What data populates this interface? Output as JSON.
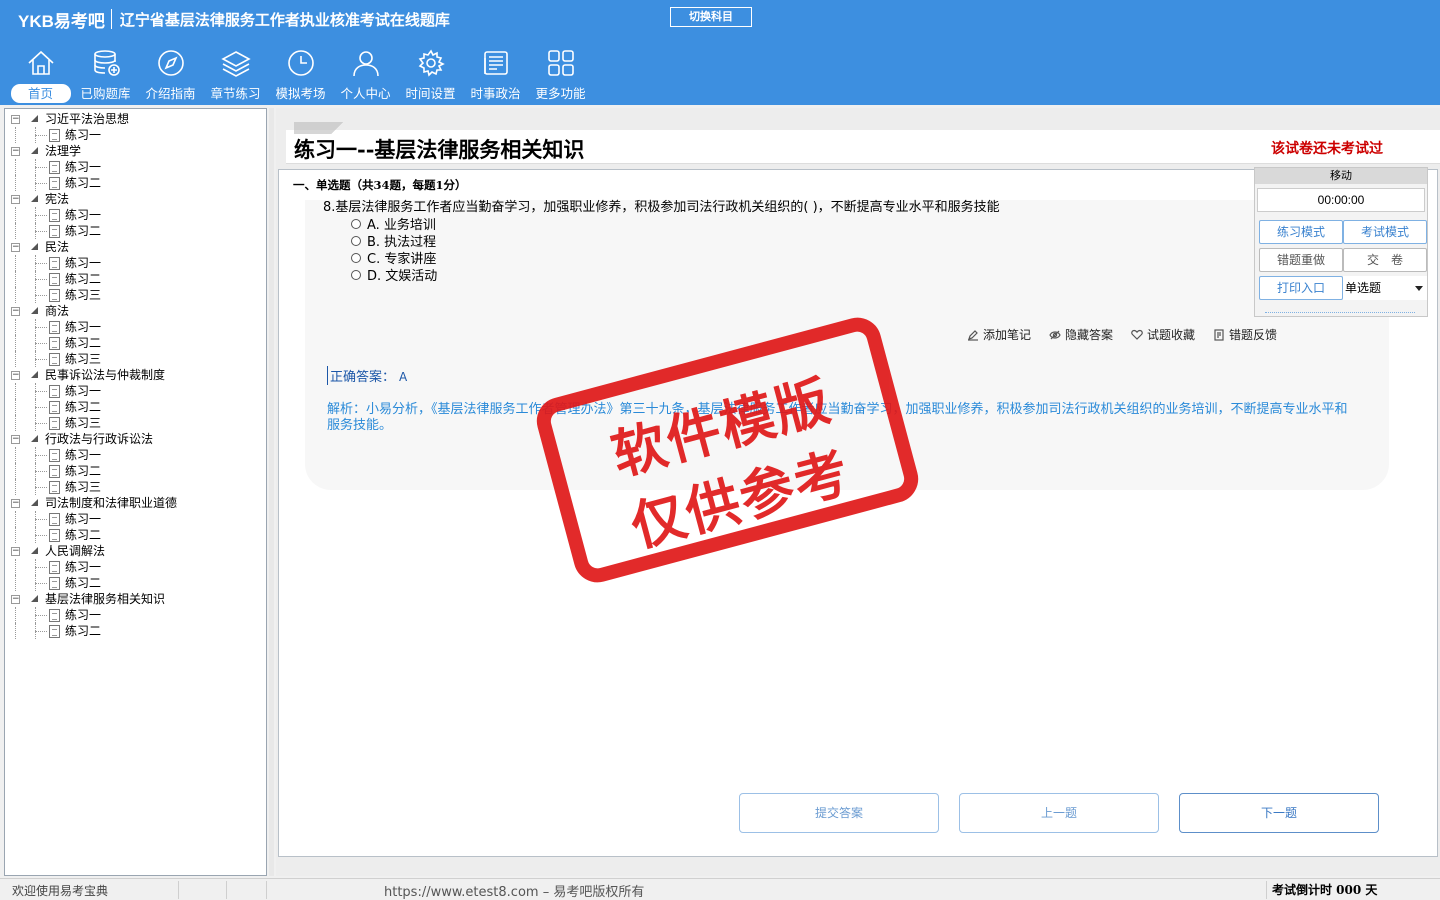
{
  "header": {
    "logo": "YKB易考吧",
    "title": "辽宁省基层法律服务工作者执业核准考试在线题库",
    "switch_subject": "切换科目"
  },
  "nav": [
    {
      "label": "首页",
      "icon": "home-icon"
    },
    {
      "label": "已购题库",
      "icon": "database-icon"
    },
    {
      "label": "介绍指南",
      "icon": "compass-icon"
    },
    {
      "label": "章节练习",
      "icon": "layers-icon"
    },
    {
      "label": "模拟考场",
      "icon": "clock-icon"
    },
    {
      "label": "个人中心",
      "icon": "user-icon"
    },
    {
      "label": "时间设置",
      "icon": "gear-icon"
    },
    {
      "label": "时事政治",
      "icon": "news-icon"
    },
    {
      "label": "更多功能",
      "icon": "grid-icon"
    }
  ],
  "tree": [
    {
      "label": "习近平法治思想",
      "children": [
        "练习一"
      ]
    },
    {
      "label": "法理学",
      "children": [
        "练习一",
        "练习二"
      ]
    },
    {
      "label": "宪法",
      "children": [
        "练习一",
        "练习二"
      ]
    },
    {
      "label": "民法",
      "children": [
        "练习一",
        "练习二",
        "练习三"
      ]
    },
    {
      "label": "商法",
      "children": [
        "练习一",
        "练习二",
        "练习三"
      ]
    },
    {
      "label": "民事诉讼法与仲裁制度",
      "children": [
        "练习一",
        "练习二",
        "练习三"
      ]
    },
    {
      "label": "行政法与行政诉讼法",
      "children": [
        "练习一",
        "练习二",
        "练习三"
      ]
    },
    {
      "label": "司法制度和法律职业道德",
      "children": [
        "练习一",
        "练习二"
      ]
    },
    {
      "label": "人民调解法",
      "children": [
        "练习一",
        "练习二"
      ]
    },
    {
      "label": "基层法律服务相关知识",
      "children": [
        "练习一",
        "练习二"
      ]
    }
  ],
  "paper": {
    "title": "练习一--基层法律服务相关知识",
    "status": "该试卷还未考试过",
    "section": "一、单选题（共34题，每题1分）"
  },
  "question": {
    "text": "8.基层法律服务工作者应当勤奋学习，加强职业修养，积极参加司法行政机关组织的( )，不断提高专业水平和服务技能",
    "options": [
      "A. 业务培训",
      "B. 执法过程",
      "C. 专家讲座",
      "D. 文娱活动"
    ],
    "answer_label": "正确答案：",
    "answer_value": "A",
    "analysis": "解析：小易分析，《基层法律服务工作者管理办法》第三十九条，基层法律服务工作者应当勤奋学习，加强职业修养，积极参加司法行政机关组织的业务培训，不断提高专业水平和服务技能。"
  },
  "actions": [
    {
      "label": "添加笔记",
      "icon": "pencil-icon"
    },
    {
      "label": "隐藏答案",
      "icon": "eye-icon"
    },
    {
      "label": "试题收藏",
      "icon": "heart-icon"
    },
    {
      "label": "错题反馈",
      "icon": "feedback-icon"
    }
  ],
  "buttons": {
    "submit": "提交答案",
    "prev": "上一题",
    "next": "下一题"
  },
  "control": {
    "move": "移动",
    "timer": "00:00:00",
    "practice_mode": "练习模式",
    "exam_mode": "考试模式",
    "redo_wrong": "错题重做",
    "hand_in": "交　卷",
    "print": "打印入口",
    "type_select": "单选题"
  },
  "watermark": {
    "line1": "软件模版",
    "line2": "仅供参考"
  },
  "status": {
    "welcome": "欢迎使用易考宝典",
    "copyright": "https://www.etest8.com – 易考吧版权所有",
    "countdown": "考试倒计时 000 天"
  }
}
